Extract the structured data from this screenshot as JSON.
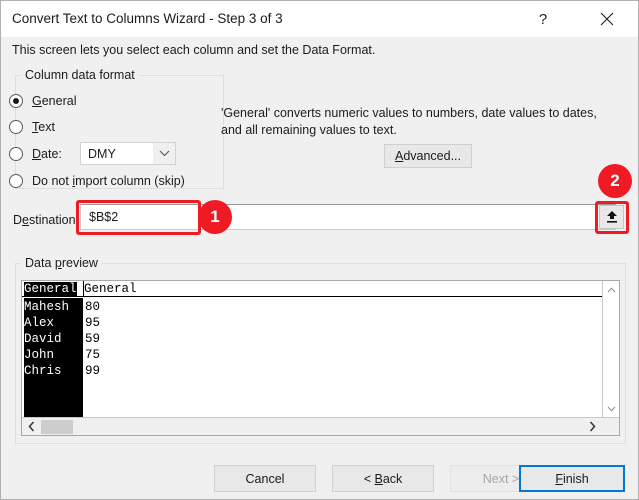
{
  "window": {
    "title": "Convert Text to Columns Wizard - Step 3 of 3",
    "help_icon": "question-mark-icon",
    "close_icon": "close-x-icon",
    "subtitle": "This screen lets you select each column and set the Data Format."
  },
  "column_format": {
    "group_label_pre": "Column data format",
    "group_label_prefix": "Column data format",
    "options": [
      {
        "label_pre": "",
        "accel": "G",
        "label_post": "eneral",
        "checked": true,
        "name": "general"
      },
      {
        "label_pre": "",
        "accel": "T",
        "label_post": "ext",
        "checked": false,
        "name": "text"
      },
      {
        "label_pre": "",
        "accel": "D",
        "label_post": "ate:",
        "checked": false,
        "name": "date"
      },
      {
        "label_pre": "Do not ",
        "accel": "i",
        "label_post": "mport column (skip)",
        "checked": false,
        "name": "skip"
      }
    ],
    "date_format": {
      "value": "DMY",
      "arrow_icon": "chevron-down-icon"
    }
  },
  "description": {
    "text": "'General' converts numeric values to numbers, date values to dates, and all remaining values to text.",
    "advanced_pre": "",
    "advanced_accel": "A",
    "advanced_post": "dvanced..."
  },
  "destination": {
    "label_pre": "D",
    "label_accel": "e",
    "label_post": "stination:",
    "value": "$B$2",
    "placeholder": "",
    "collapse_icon": "collapse-range-up-arrow-icon"
  },
  "annotations": {
    "badge_one": "1",
    "badge_two": "2",
    "highlight_color": "#ee1b24"
  },
  "data_preview": {
    "group_label_pre": "Data ",
    "group_label_accel": "p",
    "group_label_post": "review",
    "headers": [
      "General",
      "General"
    ],
    "selected_column_index": 0,
    "rows": [
      [
        "Mahesh",
        "80"
      ],
      [
        "Alex",
        "95"
      ],
      [
        "David",
        "59"
      ],
      [
        "John",
        "75"
      ],
      [
        "Chris",
        "99"
      ]
    ],
    "scroll": {
      "up_icon": "chevron-up-icon",
      "down_icon": "chevron-down-icon",
      "left_icon": "chevron-left-icon",
      "right_icon": "chevron-right-icon"
    }
  },
  "footer": {
    "cancel": "Cancel",
    "back_pre": "< ",
    "back_accel": "B",
    "back_post": "ack",
    "next": "Next >",
    "next_enabled": false,
    "finish_pre": "",
    "finish_accel": "F",
    "finish_post": "inish",
    "focus_color": "#0078d7"
  }
}
